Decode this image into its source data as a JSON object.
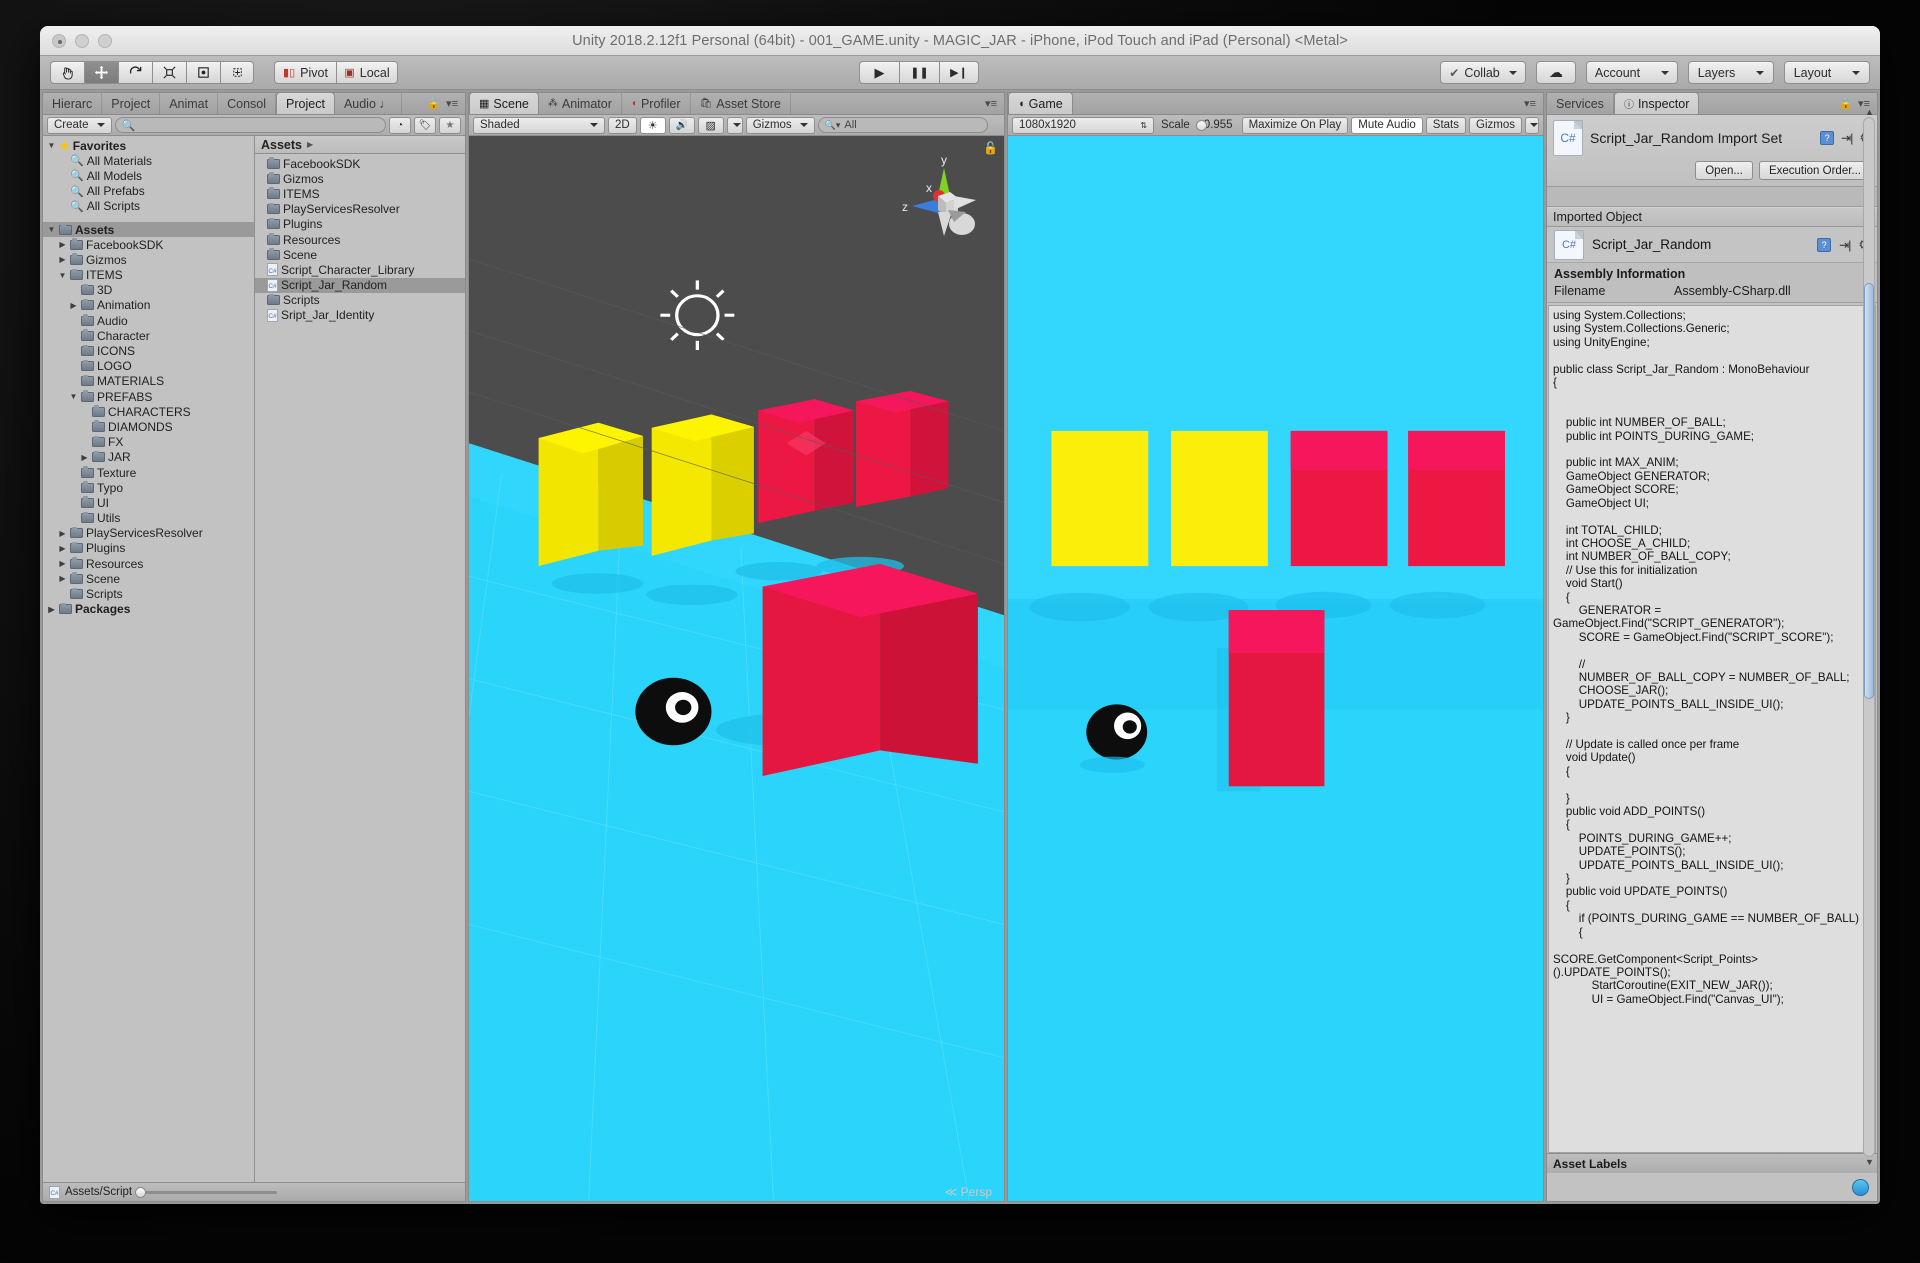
{
  "window": {
    "title": "Unity 2018.2.12f1 Personal (64bit) - 001_GAME.unity - MAGIC_JAR - iPhone, iPod Touch and iPad (Personal) <Metal>"
  },
  "toolbar": {
    "tools": [
      {
        "name": "hand-tool",
        "glyph": "✋"
      },
      {
        "name": "move-tool",
        "glyph": "✥"
      },
      {
        "name": "rotate-tool",
        "glyph": "↻"
      },
      {
        "name": "scale-tool",
        "glyph": "⤢"
      },
      {
        "name": "rect-tool",
        "glyph": "▣"
      },
      {
        "name": "transform-tool",
        "glyph": "✲"
      }
    ],
    "pivot": "Pivot",
    "local": "Local",
    "play": "▶",
    "pause": "❚❚",
    "step": "▶❙",
    "collab": "Collab",
    "cloud": "☁",
    "account": "Account",
    "layers": "Layers",
    "layout": "Layout"
  },
  "project_panel": {
    "tabs": [
      {
        "label": "Hierarc",
        "active": false
      },
      {
        "label": "Project",
        "active": false
      },
      {
        "label": "Animat",
        "active": false
      },
      {
        "label": "Consol",
        "active": false
      },
      {
        "label": "Project",
        "active": true
      },
      {
        "label": "Audio ♩",
        "active": false
      }
    ],
    "create_button": "Create",
    "search_placeholder": "",
    "tree": [
      {
        "label": "Favorites",
        "depth": 0,
        "arrow": "▼",
        "icon": "star",
        "bold": true
      },
      {
        "label": "All Materials",
        "depth": 1,
        "arrow": "",
        "icon": "magnifier"
      },
      {
        "label": "All Models",
        "depth": 1,
        "arrow": "",
        "icon": "magnifier"
      },
      {
        "label": "All Prefabs",
        "depth": 1,
        "arrow": "",
        "icon": "magnifier"
      },
      {
        "label": "All Scripts",
        "depth": 1,
        "arrow": "",
        "icon": "magnifier"
      },
      {
        "label": "",
        "depth": 0,
        "arrow": "",
        "icon": "none",
        "spacer": true
      },
      {
        "label": "Assets",
        "depth": 0,
        "arrow": "▼",
        "icon": "folder",
        "bold": true,
        "selected": true
      },
      {
        "label": "FacebookSDK",
        "depth": 1,
        "arrow": "▶",
        "icon": "folder"
      },
      {
        "label": "Gizmos",
        "depth": 1,
        "arrow": "▶",
        "icon": "folder"
      },
      {
        "label": "ITEMS",
        "depth": 1,
        "arrow": "▼",
        "icon": "folder"
      },
      {
        "label": "3D",
        "depth": 2,
        "arrow": "",
        "icon": "folder"
      },
      {
        "label": "Animation",
        "depth": 2,
        "arrow": "▶",
        "icon": "folder"
      },
      {
        "label": "Audio",
        "depth": 2,
        "arrow": "",
        "icon": "folder"
      },
      {
        "label": "Character",
        "depth": 2,
        "arrow": "",
        "icon": "folder"
      },
      {
        "label": "ICONS",
        "depth": 2,
        "arrow": "",
        "icon": "folder"
      },
      {
        "label": "LOGO",
        "depth": 2,
        "arrow": "",
        "icon": "folder"
      },
      {
        "label": "MATERIALS",
        "depth": 2,
        "arrow": "",
        "icon": "folder"
      },
      {
        "label": "PREFABS",
        "depth": 2,
        "arrow": "▼",
        "icon": "folder"
      },
      {
        "label": "CHARACTERS",
        "depth": 3,
        "arrow": "",
        "icon": "folder"
      },
      {
        "label": "DIAMONDS",
        "depth": 3,
        "arrow": "",
        "icon": "folder"
      },
      {
        "label": "FX",
        "depth": 3,
        "arrow": "",
        "icon": "folder"
      },
      {
        "label": "JAR",
        "depth": 3,
        "arrow": "▶",
        "icon": "folder"
      },
      {
        "label": "Texture",
        "depth": 2,
        "arrow": "",
        "icon": "folder"
      },
      {
        "label": "Typo",
        "depth": 2,
        "arrow": "",
        "icon": "folder"
      },
      {
        "label": "UI",
        "depth": 2,
        "arrow": "",
        "icon": "folder"
      },
      {
        "label": "Utils",
        "depth": 2,
        "arrow": "",
        "icon": "folder"
      },
      {
        "label": "PlayServicesResolver",
        "depth": 1,
        "arrow": "▶",
        "icon": "folder"
      },
      {
        "label": "Plugins",
        "depth": 1,
        "arrow": "▶",
        "icon": "folder"
      },
      {
        "label": "Resources",
        "depth": 1,
        "arrow": "▶",
        "icon": "folder"
      },
      {
        "label": "Scene",
        "depth": 1,
        "arrow": "▶",
        "icon": "folder"
      },
      {
        "label": "Scripts",
        "depth": 1,
        "arrow": "",
        "icon": "folder"
      },
      {
        "label": "Packages",
        "depth": 0,
        "arrow": "▶",
        "icon": "folder",
        "bold": true
      }
    ],
    "breadcrumb": "Assets",
    "items": [
      {
        "label": "FacebookSDK",
        "icon": "folder"
      },
      {
        "label": "Gizmos",
        "icon": "folder"
      },
      {
        "label": "ITEMS",
        "icon": "folder"
      },
      {
        "label": "PlayServicesResolver",
        "icon": "folder"
      },
      {
        "label": "Plugins",
        "icon": "folder"
      },
      {
        "label": "Resources",
        "icon": "folder"
      },
      {
        "label": "Scene",
        "icon": "folder"
      },
      {
        "label": "Script_Character_Library",
        "icon": "csharp"
      },
      {
        "label": "Script_Jar_Random",
        "icon": "csharp",
        "selected": true
      },
      {
        "label": "Scripts",
        "icon": "folder"
      },
      {
        "label": "Sript_Jar_Identity",
        "icon": "csharp"
      }
    ],
    "status_path": "Assets/Script"
  },
  "scene_panel": {
    "tabs": [
      {
        "label": "Scene",
        "icon": "grid-icon",
        "active": true
      },
      {
        "label": "Animator",
        "icon": "animator-icon",
        "active": false
      },
      {
        "label": "Profiler",
        "icon": "profiler-icon",
        "active": false
      },
      {
        "label": "Asset Store",
        "icon": "store-icon",
        "active": false
      }
    ],
    "draw_mode": "Shaded",
    "mode_2d": "2D",
    "lighting": "☀",
    "audio": "🔊",
    "fx": "▨",
    "gizmos": "Gizmos",
    "search_placeholder": "All",
    "persp_label": "Persp",
    "axis_x": "x",
    "axis_y": "y",
    "axis_z": "z"
  },
  "game_panel": {
    "tabs": [
      {
        "label": "Game",
        "icon": "game-icon",
        "active": true
      }
    ],
    "resolution": "1080x1920",
    "scale_label": "Scale",
    "scale_value": "0.955",
    "maximize_on_play": "Maximize On Play",
    "mute_audio": "Mute Audio",
    "stats": "Stats",
    "gizmos": "Gizmos"
  },
  "inspector": {
    "tabs": [
      {
        "label": "Services",
        "active": false
      },
      {
        "label": "Inspector",
        "icon": "info-icon",
        "active": true
      }
    ],
    "import_title": "Script_Jar_Random Import Set",
    "open_button": "Open...",
    "execution_order_button": "Execution Order...",
    "imported_object_header": "Imported Object",
    "imported_object_name": "Script_Jar_Random",
    "assembly_header": "Assembly Information",
    "filename_key": "Filename",
    "filename_value": "Assembly-CSharp.dll",
    "code": "using System.Collections;\nusing System.Collections.Generic;\nusing UnityEngine;\n\npublic class Script_Jar_Random : MonoBehaviour\n{\n\n\n    public int NUMBER_OF_BALL;\n    public int POINTS_DURING_GAME;\n\n    public int MAX_ANIM;\n    GameObject GENERATOR;\n    GameObject SCORE;\n    GameObject UI;\n\n    int TOTAL_CHILD;\n    int CHOOSE_A_CHILD;\n    int NUMBER_OF_BALL_COPY;\n    // Use this for initialization\n    void Start()\n    {\n        GENERATOR = GameObject.Find(\"SCRIPT_GENERATOR\");\n        SCORE = GameObject.Find(\"SCRIPT_SCORE\");\n\n        //\n        NUMBER_OF_BALL_COPY = NUMBER_OF_BALL;\n        CHOOSE_JAR();\n        UPDATE_POINTS_BALL_INSIDE_UI();\n    }\n\n    // Update is called once per frame\n    void Update()\n    {\n\n    }\n    public void ADD_POINTS()\n    {\n        POINTS_DURING_GAME++;\n        UPDATE_POINTS();\n        UPDATE_POINTS_BALL_INSIDE_UI();\n    }\n    public void UPDATE_POINTS()\n    {\n        if (POINTS_DURING_GAME == NUMBER_OF_BALL)\n        {\n\nSCORE.GetComponent<Script_Points>().UPDATE_POINTS();\n            StartCoroutine(EXIT_NEW_JAR());\n            UI = GameObject.Find(\"Canvas_UI\");",
    "asset_labels": "Asset Labels"
  },
  "colors": {
    "ground_cyan": "#2ad4fb",
    "sky_cyan": "#36d6fd",
    "cube_yellow": "#faee0a",
    "cube_red": "#ec1843",
    "cube_red_top": "#f5165c",
    "scene_bg": "#4c4c4c",
    "ball_black": "#0d0d0d"
  }
}
